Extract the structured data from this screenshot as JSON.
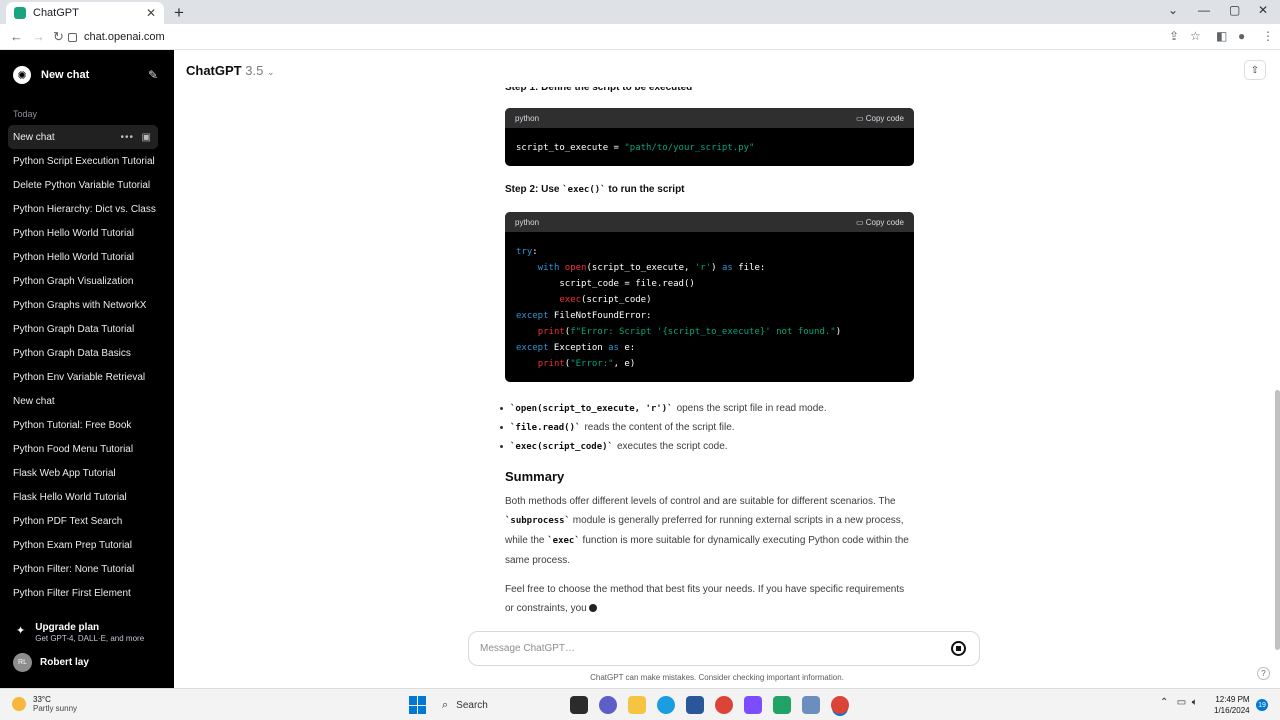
{
  "browser": {
    "tab_title": "ChatGPT",
    "url": "chat.openai.com"
  },
  "sidebar": {
    "new_chat": "New chat",
    "section": "Today",
    "items": [
      "New chat",
      "Python Script Execution Tutorial",
      "Delete Python Variable Tutorial",
      "Python Hierarchy: Dict vs. Class",
      "Python Hello World Tutorial",
      "Python Hello World Tutorial",
      "Python Graph Visualization",
      "Python Graphs with NetworkX",
      "Python Graph Data Tutorial",
      "Python Graph Data Basics",
      "Python Env Variable Retrieval",
      "New chat",
      "Python Tutorial: Free Book",
      "Python Food Menu Tutorial",
      "Flask Web App Tutorial",
      "Flask Hello World Tutorial",
      "Python PDF Text Search",
      "Python Exam Prep Tutorial",
      "Python Filter: None Tutorial",
      "Python Filter First Element"
    ],
    "upgrade_title": "Upgrade plan",
    "upgrade_sub": "Get GPT-4, DALL·E, and more",
    "user_initials": "RL",
    "user_name": "Robert lay"
  },
  "header": {
    "model": "ChatGPT",
    "version": "3.5"
  },
  "content": {
    "cut_heading": "Step 1: Define the script to be executed",
    "code1": {
      "lang": "python",
      "copy": "Copy code"
    },
    "step2_prefix": "Step 2: Use ",
    "step2_code": "`exec()`",
    "step2_suffix": " to run the script",
    "code2": {
      "lang": "python",
      "copy": "Copy code"
    },
    "bullets": [
      {
        "code": "`open(script_to_execute, 'r')`",
        "text": "opens the script file in read mode."
      },
      {
        "code": "`file.read()`",
        "text": "reads the content of the script file."
      },
      {
        "code": "`exec(script_code)`",
        "text": "executes the script code."
      }
    ],
    "summary_title": "Summary",
    "summary_p1": "Both methods offer different levels of control and are suitable for different scenarios.",
    "summary_p2_a": "The ",
    "summary_p2_code1": "`subprocess`",
    "summary_p2_b": " module is generally preferred for running external scripts in a new process, while the ",
    "summary_p2_code2": "`exec`",
    "summary_p2_c": " function is more suitable for dynamically executing Python code within the same process.",
    "closing": "Feel free to choose the method that best fits your needs. If you have specific requirements or constraints, you"
  },
  "composer": {
    "placeholder": "Message ChatGPT…",
    "disclaimer": "ChatGPT can make mistakes. Consider checking important information."
  },
  "taskbar": {
    "temp": "33°C",
    "weather": "Partly sunny",
    "search": "Search",
    "time": "12:49 PM",
    "date": "1/16/2024",
    "notifications": "19"
  },
  "colors": {
    "sidebar_bg": "#000000",
    "code_keyword": "#2e95d3",
    "code_string": "#00a67d",
    "code_func": "#f22c3d"
  }
}
